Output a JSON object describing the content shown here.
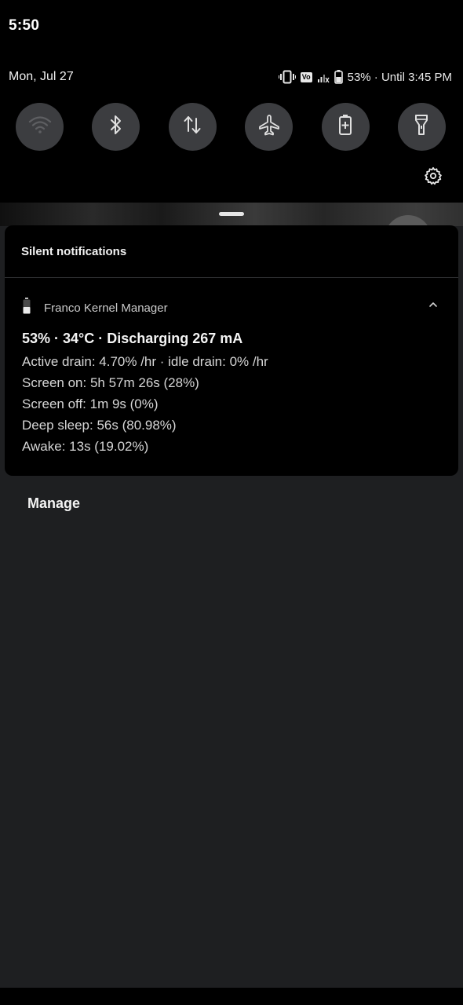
{
  "status_bar": {
    "time": "5:50"
  },
  "qs_header": {
    "date": "Mon, Jul 27",
    "volte_label": "Vo",
    "battery_text": "53% · Until 3:45 PM"
  },
  "quick_settings": {
    "tiles": [
      {
        "icon": "wifi-icon",
        "active": false
      },
      {
        "icon": "bluetooth-icon",
        "active": false
      },
      {
        "icon": "mobile-data-icon",
        "active": false
      },
      {
        "icon": "airplane-icon",
        "active": false
      },
      {
        "icon": "battery-saver-icon",
        "active": false
      },
      {
        "icon": "flashlight-icon",
        "active": false
      }
    ],
    "settings_icon": "gear-icon"
  },
  "notifications": {
    "section_header": "Silent notifications",
    "items": [
      {
        "app_name": "Franco Kernel Manager",
        "app_icon": "battery-icon",
        "title": "53% · 34°C · Discharging 267 mA",
        "lines": [
          "Active drain: 4.70% /hr · idle drain: 0% /hr",
          "Screen on: 5h 57m 26s  (28%)",
          "Screen off: 1m 9s  (0%)",
          "Deep sleep: 56s  (80.98%)",
          "Awake: 13s  (19.02%)"
        ]
      }
    ],
    "manage_label": "Manage"
  }
}
